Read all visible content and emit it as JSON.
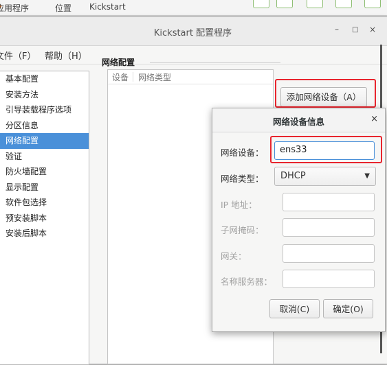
{
  "topbar": {
    "applications": "应用程序",
    "places": "位置",
    "app_name": "Kickstart"
  },
  "window": {
    "title": "Kickstart 配置程序",
    "min": "–",
    "max": "□",
    "close": "×"
  },
  "menubar": {
    "file": "文件（F）",
    "help": "帮助（H）"
  },
  "sidebar": {
    "items": [
      {
        "label": "基本配置"
      },
      {
        "label": "安装方法"
      },
      {
        "label": "引导装载程序选项"
      },
      {
        "label": "分区信息"
      },
      {
        "label": "网络配置"
      },
      {
        "label": "验证"
      },
      {
        "label": "防火墙配置"
      },
      {
        "label": "显示配置"
      },
      {
        "label": "软件包选择"
      },
      {
        "label": "预安装脚本"
      },
      {
        "label": "安装后脚本"
      }
    ],
    "selected": "网络配置"
  },
  "network": {
    "section_title": "网络配置",
    "columns": [
      "设备",
      "网络类型"
    ],
    "add_button": "添加网络设备（A）"
  },
  "dialog": {
    "title": "网络设备信息",
    "close": "×",
    "device_label": "网络设备：",
    "device_value": "ens33",
    "type_label": "网络类型：",
    "type_value": "DHCP",
    "ip_label": "IP 地址：",
    "netmask_label": "子网掩码：",
    "gateway_label": "网关：",
    "dns_label": "名称服务器：",
    "cancel_button": "取消(C)",
    "ok_button": "确定(O)"
  },
  "colors": {
    "selection": "#4a90d9",
    "highlight": "#e8252e"
  }
}
